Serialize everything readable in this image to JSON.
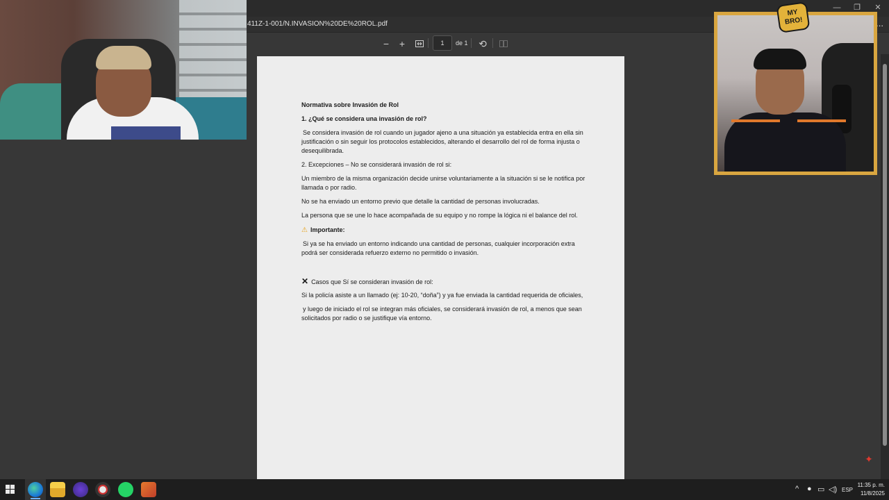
{
  "browser": {
    "url": "411Z-1-001/N.INVASION%20DE%20ROL.pdf",
    "more_label": "..."
  },
  "pdf_toolbar": {
    "zoom_out": "−",
    "zoom_in": "+",
    "current_page": "1",
    "page_total": "de 1"
  },
  "document": {
    "title": "Normativa sobre Invasión de Rol",
    "q1_heading": "1. ¿Qué se considera una invasión de rol?",
    "q1_body": "Se considera invasión de rol cuando un jugador ajeno a una situación ya establecida entra en ella sin justificación o sin seguir los protocolos establecidos, alterando el desarrollo del rol de forma injusta o desequilibrada.",
    "q2_heading": "2. Excepciones – No se considerará invasión de rol si:",
    "exception_1": "Un miembro de la misma organización decide unirse voluntariamente a la situación  si se le notifica por llamada o por radio.",
    "exception_2": "No se ha enviado un entorno previo que detalle la cantidad de personas involucradas.",
    "exception_3": "La persona que se une lo hace acompañada de su equipo y no rompe la lógica ni el balance del rol.",
    "important_label": "Importante:",
    "important_body": "Si ya se ha enviado un entorno indicando una cantidad de personas, cualquier incorporación extra podrá ser considerada refuerzo externo no permitido o invasión.",
    "cases_heading": "Casos que Sí se consideran invasión de rol:",
    "case_line_1": "Si la policía asiste a un llamado (ej: 10-20, “doña”) y ya fue enviada la cantidad requerida de oficiales,",
    "case_line_2": "y luego de iniciado el rol se integran más oficiales, se considerará invasión de rol, a menos que sean solicitados por radio o se justifique vía entorno."
  },
  "overlay": {
    "logo_text": "MY BRO!"
  },
  "taskbar": {
    "language": "ESP",
    "time": "11:35 p. m.",
    "date": "11/8/2025"
  },
  "colors": {
    "accent_warning": "#e7a21b",
    "frame_gold": "#d9a640",
    "acrobat_red": "#e03a2f"
  }
}
